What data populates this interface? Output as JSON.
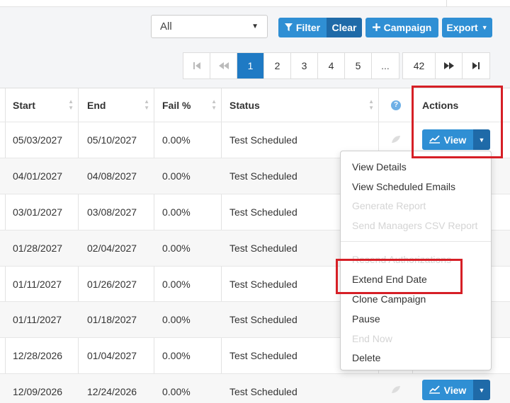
{
  "filters": {
    "select_value": "All",
    "filter_label": "Filter",
    "clear_label": "Clear",
    "campaign_label": "Campaign",
    "export_label": "Export"
  },
  "pagination": {
    "pages": [
      "1",
      "2",
      "3",
      "4",
      "5"
    ],
    "ellipsis": "...",
    "last_page": "42",
    "current": "1"
  },
  "table": {
    "headers": {
      "start": "Start",
      "end": "End",
      "fail": "Fail %",
      "status": "Status",
      "help": "?",
      "actions": "Actions"
    },
    "rows": [
      {
        "start": "05/03/2027",
        "end": "05/10/2027",
        "fail": "0.00%",
        "status": "Test Scheduled"
      },
      {
        "start": "04/01/2027",
        "end": "04/08/2027",
        "fail": "0.00%",
        "status": "Test Scheduled"
      },
      {
        "start": "03/01/2027",
        "end": "03/08/2027",
        "fail": "0.00%",
        "status": "Test Scheduled"
      },
      {
        "start": "01/28/2027",
        "end": "02/04/2027",
        "fail": "0.00%",
        "status": "Test Scheduled"
      },
      {
        "start": "01/11/2027",
        "end": "01/26/2027",
        "fail": "0.00%",
        "status": "Test Scheduled"
      },
      {
        "start": "01/11/2027",
        "end": "01/18/2027",
        "fail": "0.00%",
        "status": "Test Scheduled"
      },
      {
        "start": "12/28/2026",
        "end": "01/04/2027",
        "fail": "0.00%",
        "status": "Test Scheduled"
      },
      {
        "start": "12/09/2026",
        "end": "12/24/2026",
        "fail": "0.00%",
        "status": "Test Scheduled"
      }
    ],
    "view_label": "View"
  },
  "menu": {
    "items": [
      {
        "label": "View Details",
        "enabled": true
      },
      {
        "label": "View Scheduled Emails",
        "enabled": true
      },
      {
        "label": "Generate Report",
        "enabled": false
      },
      {
        "label": "Send Managers CSV Report",
        "enabled": false
      },
      {
        "label": "Resend Authorizations",
        "enabled": false
      },
      {
        "label": "Extend End Date",
        "enabled": true
      },
      {
        "label": "Clone Campaign",
        "enabled": true
      },
      {
        "label": "Pause",
        "enabled": true
      },
      {
        "label": "End Now",
        "enabled": false
      },
      {
        "label": "Delete",
        "enabled": true
      }
    ]
  },
  "colors": {
    "primary": "#2f8fd4",
    "primary_dark": "#1f6aa8",
    "highlight": "#d61f26"
  }
}
